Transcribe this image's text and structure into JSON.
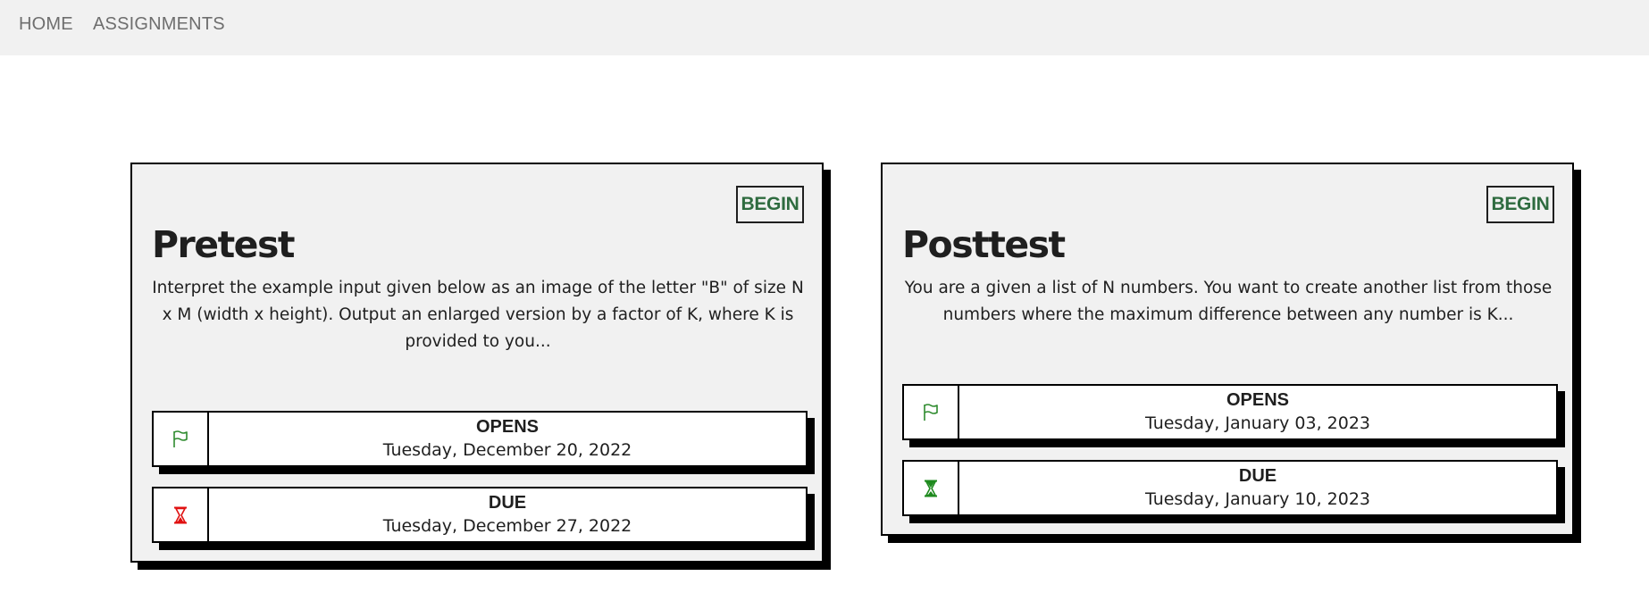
{
  "nav": {
    "home": "HOME",
    "assignments": "ASSIGNMENTS"
  },
  "colors": {
    "begin_text": "#2e6b3f",
    "flag_icon": "#2e8b2e",
    "hourglass_due_passed": "#e01010",
    "hourglass_due_upcoming": "#1e8a1e"
  },
  "cards": [
    {
      "begin_label": "BEGIN",
      "title": "Pretest",
      "description": "Interpret the example input given below as an image of the letter \"B\" of size N x M (width x height). Output an enlarged version by a factor of K, where K is provided to you...",
      "opens_label": "OPENS",
      "opens_date": "Tuesday, December 20, 2022",
      "opens_icon": "flag-icon",
      "due_label": "DUE",
      "due_date": "Tuesday, December 27, 2022",
      "due_icon": "hourglass-icon",
      "due_icon_color": "red"
    },
    {
      "begin_label": "BEGIN",
      "title": "Posttest",
      "description": "You are a given a list of N numbers. You want to create another list from those numbers where the maximum difference between any number is K...",
      "opens_label": "OPENS",
      "opens_date": "Tuesday, January 03, 2023",
      "opens_icon": "flag-icon",
      "due_label": "DUE",
      "due_date": "Tuesday, January 10, 2023",
      "due_icon": "hourglass-icon",
      "due_icon_color": "green"
    }
  ]
}
